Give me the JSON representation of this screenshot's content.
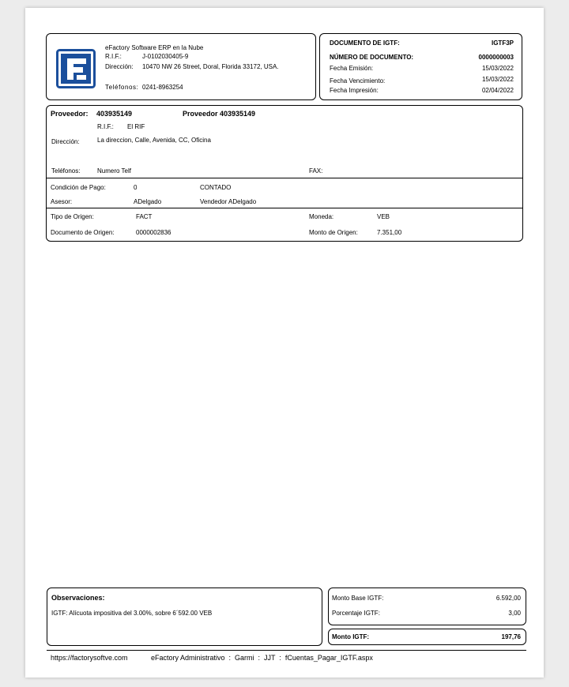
{
  "company": {
    "name": "eFactory Software ERP en la Nube",
    "rif_label": "R.I.F.:",
    "rif": "J-0102030405-9",
    "address_label": "Dirección:",
    "address": "10470 NW 26 Street, Doral, Florida 33172, USA.",
    "phones_label": "Teléfonos:",
    "phones": "0241-8963254",
    "logo_icon": "efactory-logo-icon",
    "brand_color": "#1b4f9c"
  },
  "doc": {
    "title_label": "DOCUMENTO DE IGTF:",
    "title_value": "IGTF3P",
    "number_label": "NÚMERO DE DOCUMENTO:",
    "number_value": "0000000003",
    "emission_label": "Fecha Emisión:",
    "emission_value": "15/03/2022",
    "due_label": "Fecha Vencimiento:",
    "due_value": "15/03/2022",
    "print_label": "Fecha Impresión:",
    "print_value": "02/04/2022"
  },
  "provider": {
    "label": "Proveedor:",
    "code": "403935149",
    "name": "Proveedor 403935149",
    "rif_label": "R.I.F.:",
    "rif": "El RIF",
    "address_label": "Dirección:",
    "address": "La direccion, Calle, Avenida, CC, Oficina",
    "phones_label": "Teléfonos:",
    "phones": "Numero Telf",
    "fax_label": "FAX:",
    "fax": "",
    "payment_label": "Condición de Pago:",
    "payment_code": "0",
    "payment_name": "CONTADO",
    "advisor_label": "Asesor:",
    "advisor_code": "ADelgado",
    "advisor_name": "Vendedor ADelgado",
    "origin_type_label": "Tipo de Origen:",
    "origin_type": "FACT",
    "currency_label": "Moneda:",
    "currency": "VEB",
    "origin_doc_label": "Documento de Origen:",
    "origin_doc": "0000002836",
    "origin_amount_label": "Monto de Origen:",
    "origin_amount": "7.351,00"
  },
  "notes": {
    "title": "Observaciones:",
    "text": "IGTF: Alícuota impositiva del 3.00%, sobre 6´592.00 VEB"
  },
  "totals": {
    "base_label": "Monto Base IGTF:",
    "base_value": "6.592,00",
    "pct_label": "Porcentaje IGTF:",
    "pct_value": "3,00",
    "total_label": "Monto IGTF:",
    "total_value": "197,76"
  },
  "footer": {
    "url": "https://factorysoftve.com",
    "info": "eFactory Administrativo  :  Garmi  :  JJT  :  fCuentas_Pagar_IGTF.aspx"
  }
}
